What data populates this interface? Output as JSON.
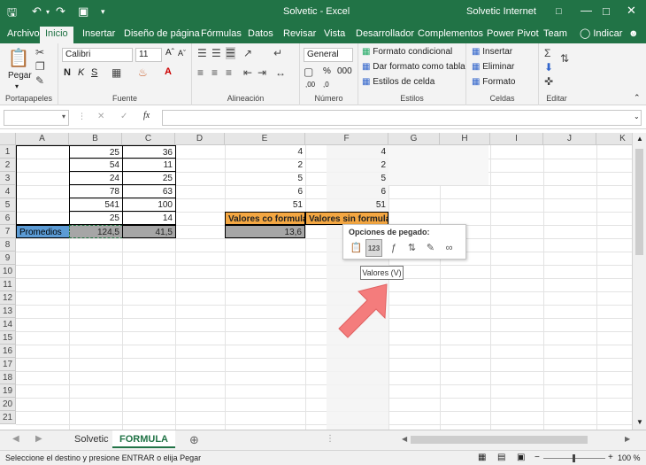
{
  "titlebar": {
    "doc_title": "Solvetic  -  Excel",
    "account": "Solvetic Internet"
  },
  "tabs": [
    "Archivo",
    "Inicio",
    "Insertar",
    "Diseño de página",
    "Fórmulas",
    "Datos",
    "Revisar",
    "Vista",
    "Desarrollador",
    "Complementos",
    "Power Pivot",
    "Team"
  ],
  "active_tab": "Inicio",
  "tell_me": "Indicar",
  "ribbon": {
    "clipboard": {
      "paste": "Pegar",
      "label": "Portapapeles"
    },
    "font": {
      "name": "Calibri",
      "size": "11",
      "label": "Fuente"
    },
    "alignment": {
      "label": "Alineación"
    },
    "number": {
      "format": "General",
      "label": "Número"
    },
    "styles": {
      "items": [
        "Formato condicional",
        "Dar formato como tabla",
        "Estilos de celda"
      ],
      "label": "Estilos"
    },
    "cells": {
      "items": [
        "Insertar",
        "Eliminar",
        "Formato"
      ],
      "label": "Celdas"
    },
    "editing": {
      "label": "Editar"
    }
  },
  "formula_bar": {
    "fx": "fx",
    "value": ""
  },
  "columns": [
    "A",
    "B",
    "C",
    "D",
    "E",
    "F",
    "G",
    "H",
    "I",
    "J",
    "K"
  ],
  "rows": [
    "1",
    "2",
    "3",
    "4",
    "5",
    "6",
    "7",
    "8",
    "9",
    "10",
    "11",
    "12",
    "13",
    "14",
    "15",
    "16",
    "17",
    "18",
    "19",
    "20",
    "21"
  ],
  "cells": {
    "B": [
      "25",
      "54",
      "24",
      "78",
      "541",
      "25",
      "124,5"
    ],
    "C": [
      "36",
      "11",
      "25",
      "63",
      "100",
      "14",
      "41,5"
    ],
    "E": [
      "4",
      "2",
      "5",
      "6",
      "51"
    ],
    "F": [
      "4",
      "2",
      "5",
      "6",
      "51"
    ],
    "A7": "Promedios",
    "E6": "Valores co formula",
    "F6": "Valores sin formula",
    "E7": "13,6"
  },
  "paste_options": {
    "title": "Opciones de pegado:",
    "tooltip": "Valores (V)",
    "selected_icon": "123"
  },
  "sheets": [
    "Solvetic",
    "FORMULA"
  ],
  "active_sheet": "FORMULA",
  "status": {
    "message": "Seleccione el destino y presione ENTRAR o elija Pegar",
    "zoom": "100 %"
  },
  "colors": {
    "excel_green": "#217346",
    "orange": "#f4a742",
    "blue": "#5b9bd5",
    "gray": "#a6a6a6",
    "arrow": "#f47c7c"
  }
}
